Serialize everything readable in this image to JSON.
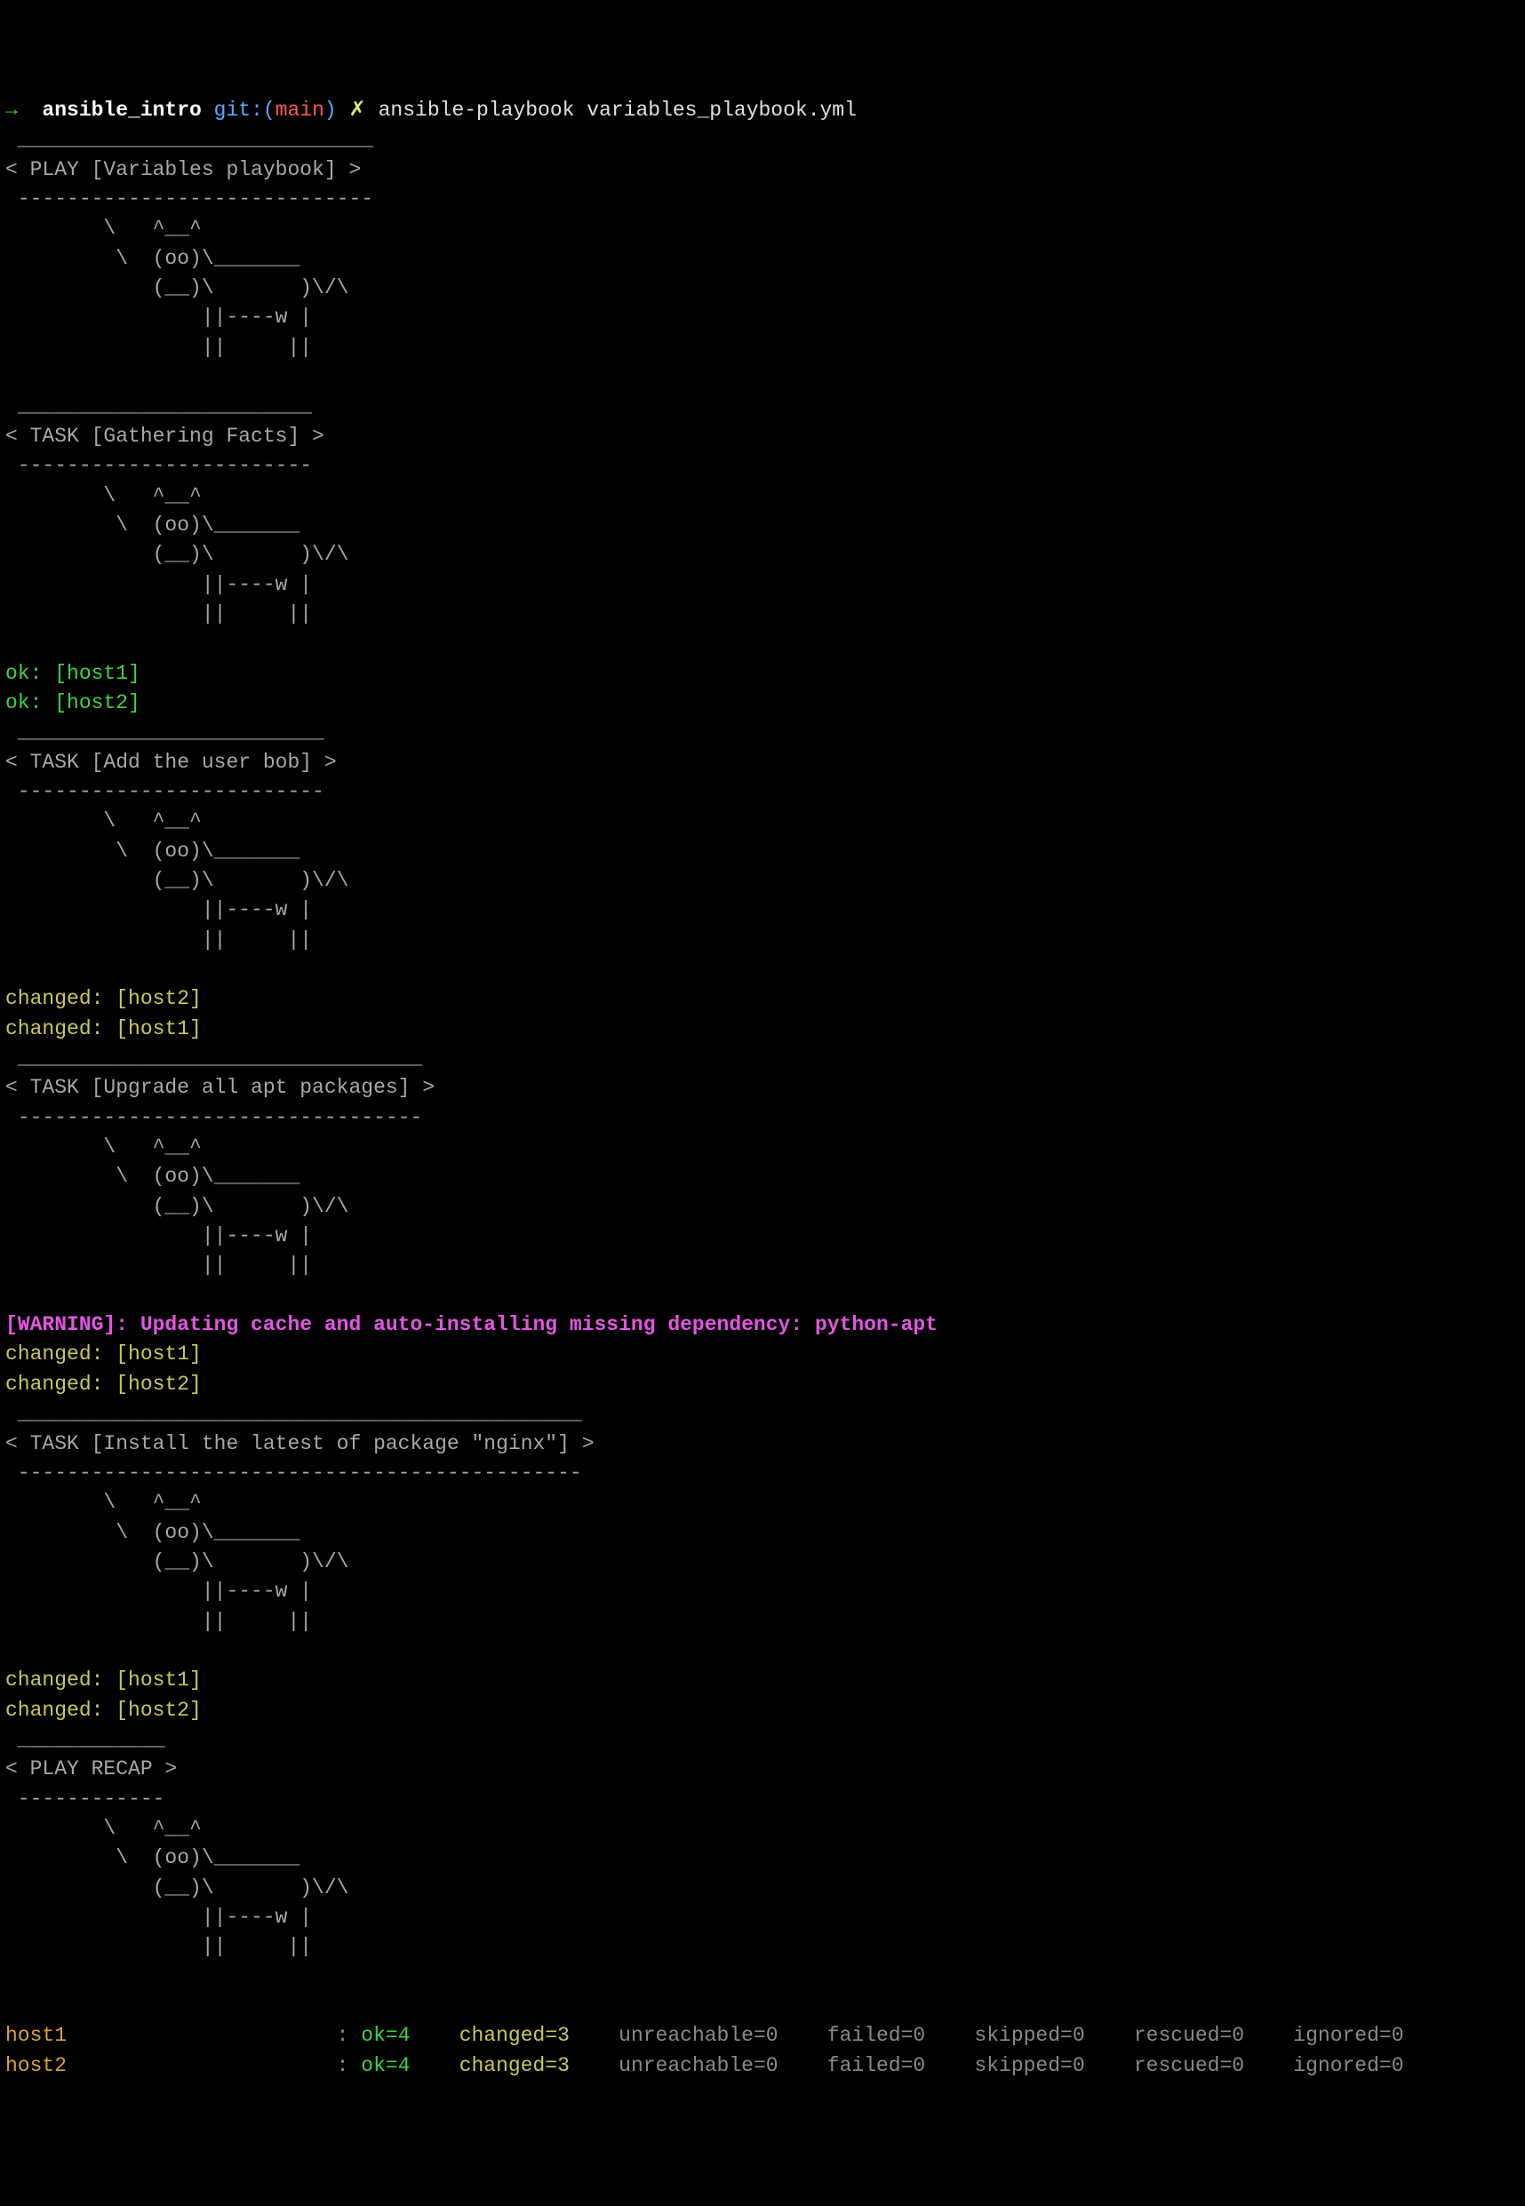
{
  "prompt": {
    "arrow": "→",
    "project": "ansible_intro",
    "git": "git:(",
    "branch": "main",
    "close": ")",
    "mark": "✗",
    "command": "ansible-playbook variables_playbook.yml"
  },
  "sections": [
    {
      "border_top": " _____________________________ ",
      "header": "< PLAY [Variables playbook] >",
      "border_bot": " ----------------------------- ",
      "cow": [
        "        \\   ^__^",
        "         \\  (oo)\\_______",
        "            (__)\\       )\\/\\",
        "                ||----w |",
        "                ||     ||"
      ],
      "results": []
    },
    {
      "border_top": " ________________________ ",
      "header": "< TASK [Gathering Facts] >",
      "border_bot": " ------------------------ ",
      "cow": [
        "        \\   ^__^",
        "         \\  (oo)\\_______",
        "            (__)\\       )\\/\\",
        "                ||----w |",
        "                ||     ||"
      ],
      "results": [
        {
          "text": "ok: [host1]",
          "class": "green"
        },
        {
          "text": "ok: [host2]",
          "class": "green"
        }
      ]
    },
    {
      "border_top": " _________________________ ",
      "header": "< TASK [Add the user bob] >",
      "border_bot": " ------------------------- ",
      "cow": [
        "        \\   ^__^",
        "         \\  (oo)\\_______",
        "            (__)\\       )\\/\\",
        "                ||----w |",
        "                ||     ||"
      ],
      "results": [
        {
          "text": "changed: [host2]",
          "class": "yellow"
        },
        {
          "text": "changed: [host1]",
          "class": "yellow"
        }
      ]
    },
    {
      "border_top": " _________________________________ ",
      "header": "< TASK [Upgrade all apt packages] >",
      "border_bot": " --------------------------------- ",
      "cow": [
        "        \\   ^__^",
        "         \\  (oo)\\_______",
        "            (__)\\       )\\/\\",
        "                ||----w |",
        "                ||     ||"
      ],
      "warning": "[WARNING]: Updating cache and auto-installing missing dependency: python-apt",
      "results": [
        {
          "text": "changed: [host1]",
          "class": "yellow"
        },
        {
          "text": "changed: [host2]",
          "class": "yellow"
        }
      ]
    },
    {
      "border_top": " ______________________________________________ ",
      "header": "< TASK [Install the latest of package \"nginx\"] >",
      "border_bot": " ---------------------------------------------- ",
      "cow": [
        "        \\   ^__^",
        "         \\  (oo)\\_______",
        "            (__)\\       )\\/\\",
        "                ||----w |",
        "                ||     ||"
      ],
      "results": [
        {
          "text": "changed: [host1]",
          "class": "yellow"
        },
        {
          "text": "changed: [host2]",
          "class": "yellow"
        }
      ]
    },
    {
      "border_top": " ____________ ",
      "header": "< PLAY RECAP >",
      "border_bot": " ------------ ",
      "cow": [
        "        \\   ^__^",
        "         \\  (oo)\\_______",
        "            (__)\\       )\\/\\",
        "                ||----w |",
        "                ||     ||"
      ],
      "results": []
    }
  ],
  "recap": [
    {
      "host": "host1",
      "ok": "ok=4",
      "changed": "changed=3",
      "unreachable": "unreachable=0",
      "failed": "failed=0",
      "skipped": "skipped=0",
      "rescued": "rescued=0",
      "ignored": "ignored=0"
    },
    {
      "host": "host2",
      "ok": "ok=4",
      "changed": "changed=3",
      "unreachable": "unreachable=0",
      "failed": "failed=0",
      "skipped": "skipped=0",
      "rescued": "rescued=0",
      "ignored": "ignored=0"
    }
  ]
}
